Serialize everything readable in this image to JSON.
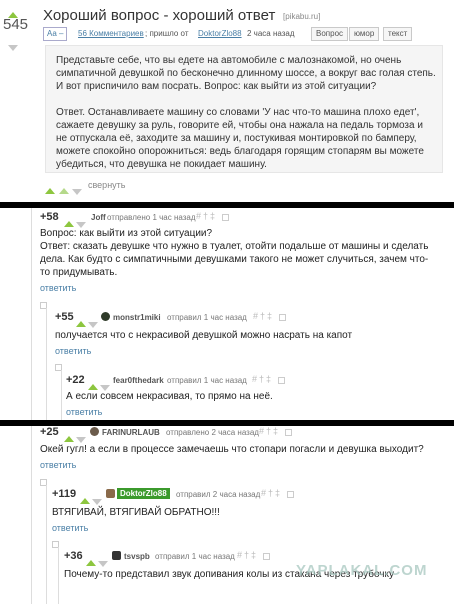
{
  "post": {
    "rating": "545",
    "title": "Хороший вопрос - хороший ответ",
    "source": "[pikabu.ru]",
    "font_toggle": "Aa –",
    "comments_link": "56 Комментариев",
    "meta_prefix": "; пришло от",
    "author": "DoktorZlo88",
    "time": "2 часа назад",
    "tags": [
      "Вопрос",
      "юмор",
      "текст"
    ],
    "paragraph1": "Представьте себе, что вы едете на автомобиле с малознакомой, но очень симпатичной девушкой по бесконечно длинному шоссе, а вокруг вас голая степь. И вот приспичило вам посрать. Вопрос: как выйти из этой ситуации?",
    "paragraph2": "Ответ. Останавливаете машину со словами 'У нас что-то машина плохо едет', сажаете девушку за руль, говорите ей, чтобы она нажала на педаль тормоза и не отпускала её, заходите за машину и, постукивая монтировкой по бамперу, можете спокойно опорожниться: ведь благодаря горящим стопарям вы можете убедиться, что девушка не покидает машину.",
    "collapse": "свернуть"
  },
  "comments1": {
    "c1": {
      "score": "+58",
      "author": "Joff",
      "meta": "отправлено 1 час назад",
      "text": "Вопрос: как выйти из этой ситуации?\nОтвет: сказать девушке что нужно в туалет, отойти подальше от машины и сделать дела. Как будто с симпатичными девушками такого не может случиться, зачем что-то придумывать.",
      "reply": "ответить"
    },
    "c2": {
      "score": "+55",
      "author": "monstr1miki",
      "meta": "отправил 1 час назад",
      "text": "получается что с некрасивой девушкой можно насрать на капот",
      "reply": "ответить"
    },
    "c3": {
      "score": "+22",
      "author": "fear0fthedark",
      "meta": "отправил 1 час назад",
      "text": "А если совсем некрасивая, то прямо на неё.",
      "reply": "ответить"
    }
  },
  "comments2": {
    "c1": {
      "score": "+25",
      "author": "FARINURLAUB",
      "meta": "отправлено 2 часа назад",
      "text": "Окей гугл! а если в процессе замечаешь что стопари погасли и девушка выходит?",
      "reply": "ответить"
    },
    "c2": {
      "score": "+119",
      "author": "DoktorZlo88",
      "meta": "отправил 2 часа назад",
      "text": "ВТЯГИВАЙ, ВТЯГИВАЙ ОБРАТНО!!!",
      "reply": "ответить"
    },
    "c3": {
      "score": "+36",
      "author": "tsvspb",
      "meta": "отправил 1 час назад",
      "text": "Почему-то представил звук допивания колы из стакана через трубочку"
    }
  },
  "watermark": "YAPLAKAL.COM",
  "colors": {
    "link": "#4a7fa6",
    "upvote": "#8dc63f",
    "separator": "#000000",
    "author_badge": "#3b9a2c"
  }
}
